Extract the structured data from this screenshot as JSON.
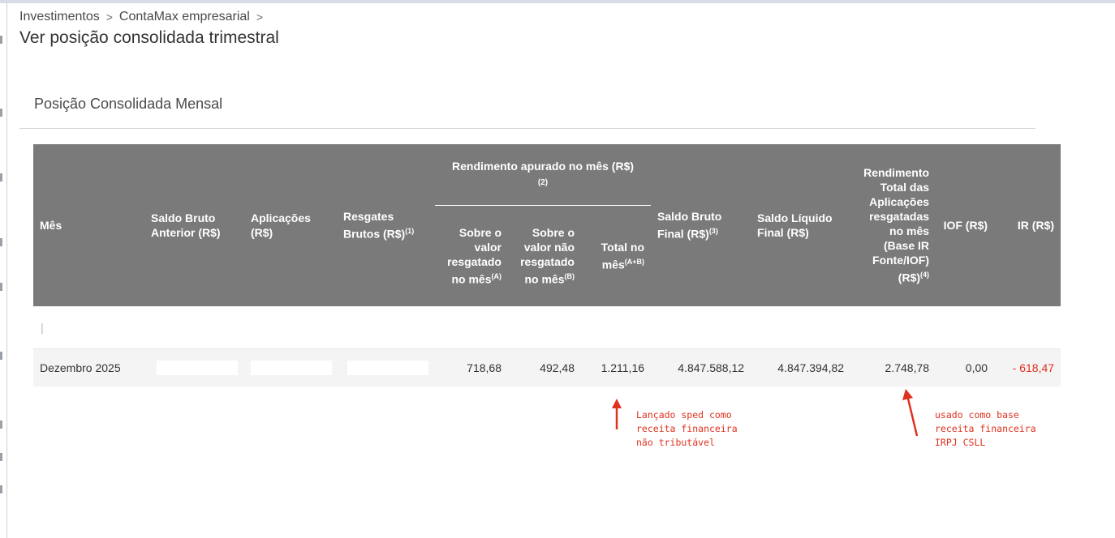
{
  "breadcrumb": {
    "item1": "Investimentos",
    "sep": ">",
    "item2": "ContaMax empresarial"
  },
  "page_title": "Ver posição consolidada trimestral",
  "section_title": "Posição Consolidada Mensal",
  "table": {
    "headers": {
      "mes": "Mês",
      "saldo_bruto_anterior": "Saldo Bruto Anterior (R$)",
      "aplicacoes": "Aplicações (R$)",
      "resgates_brutos": "Resgates Brutos (R$)",
      "resgates_sup": "(1)",
      "rendimento_group": "Rendimento apurado no mês (R$)",
      "rendimento_group_sup": "(2)",
      "sobre_resgatado": "Sobre o valor resgatado no mês",
      "sobre_resgatado_sup": "(A)",
      "sobre_nao_resgatado": "Sobre o valor não resgatado no mês",
      "sobre_nao_resgatado_sup": "(B)",
      "total_mes": "Total no mês",
      "total_mes_sup": "(A+B)",
      "saldo_bruto_final": "Saldo Bruto Final (R$)",
      "saldo_bruto_final_sup": "(3)",
      "saldo_liquido_final": "Saldo Líquido Final (R$)",
      "rendimento_total": "Rendimento Total das Aplicações resgatadas no mês (Base IR Fonte/IOF) (R$)",
      "rendimento_total_sup": "(4)",
      "iof": "IOF (R$)",
      "ir": "IR (R$)"
    },
    "rows": [
      {
        "mes": "Dezembro 2025",
        "sobre_resgatado": "718,68",
        "sobre_nao_resgatado": "492,48",
        "total_mes": "1.211,16",
        "saldo_bruto_final": "4.847.588,12",
        "saldo_liquido_final": "4.847.394,82",
        "rendimento_total": "2.748,78",
        "iof": "0,00",
        "ir": "- 618,47"
      }
    ]
  },
  "annotations": {
    "left": "Lançado sped como receita financeira não tributável",
    "right": "usado como base receita financeira IRPJ CSLL"
  },
  "colors": {
    "header_bg": "#7a7a7a",
    "negative": "#e0301e",
    "annotation": "#e0301e"
  }
}
